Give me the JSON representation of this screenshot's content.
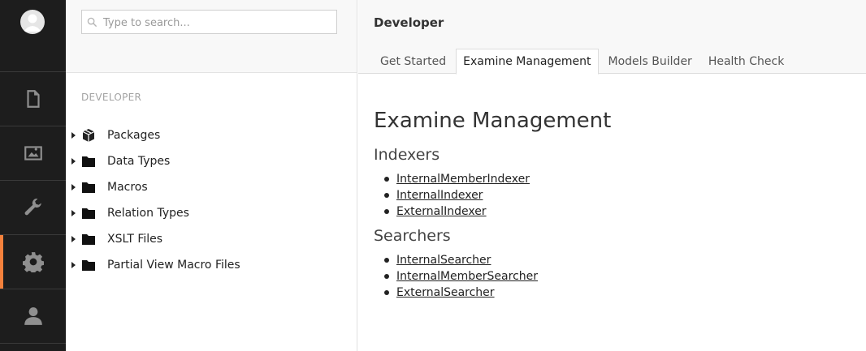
{
  "appbar": {
    "sections": [
      {
        "icon": "document-icon",
        "active": false
      },
      {
        "icon": "image-icon",
        "active": false
      },
      {
        "icon": "wrench-icon",
        "active": false
      },
      {
        "icon": "gear-icon",
        "active": true
      },
      {
        "icon": "user-icon",
        "active": false
      }
    ],
    "accent_color": "#f5813c"
  },
  "tree": {
    "search_placeholder": "Type to search...",
    "title": "DEVELOPER",
    "items": [
      {
        "label": "Packages",
        "icon": "package-icon"
      },
      {
        "label": "Data Types",
        "icon": "folder-icon"
      },
      {
        "label": "Macros",
        "icon": "folder-icon"
      },
      {
        "label": "Relation Types",
        "icon": "folder-icon"
      },
      {
        "label": "XSLT Files",
        "icon": "folder-icon"
      },
      {
        "label": "Partial View Macro Files",
        "icon": "folder-icon"
      }
    ]
  },
  "main": {
    "section_title": "Developer",
    "tabs": [
      {
        "label": "Get Started"
      },
      {
        "label": "Examine Management"
      },
      {
        "label": "Models Builder"
      },
      {
        "label": "Health Check"
      }
    ],
    "active_tab": "Examine Management",
    "content_title": "Examine Management",
    "indexers_title": "Indexers",
    "indexers": [
      "InternalMemberIndexer",
      "InternalIndexer",
      "ExternalIndexer"
    ],
    "searchers_title": "Searchers",
    "searchers": [
      "InternalSearcher",
      "InternalMemberSearcher",
      "ExternalSearcher"
    ]
  }
}
